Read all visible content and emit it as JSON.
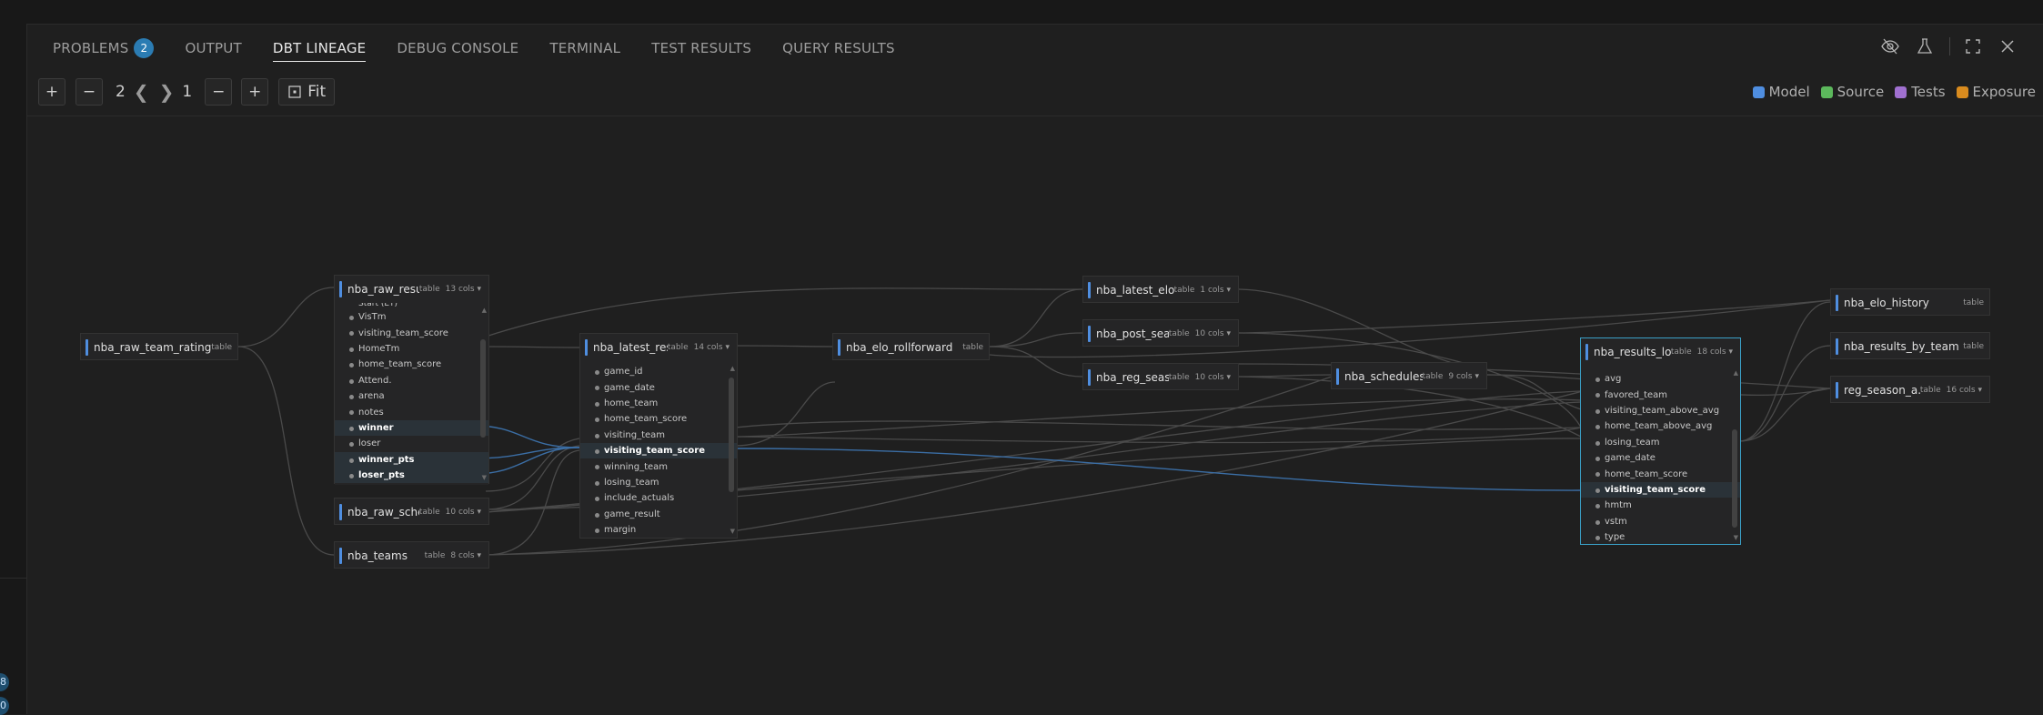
{
  "left_badges": [
    "8",
    "0"
  ],
  "tabs": [
    {
      "label": "PROBLEMS",
      "count": "2"
    },
    {
      "label": "OUTPUT"
    },
    {
      "label": "DBT LINEAGE"
    },
    {
      "label": "DEBUG CONSOLE"
    },
    {
      "label": "TERMINAL"
    },
    {
      "label": "TEST RESULTS"
    },
    {
      "label": "QUERY RESULTS"
    }
  ],
  "toolbar": {
    "zoom_in": "+",
    "zoom_out": "−",
    "upstream_depth": "2",
    "downstream_depth": "1",
    "depth_minus": "−",
    "depth_plus": "+",
    "fit_label": "Fit"
  },
  "legend": [
    {
      "label": "Model",
      "color": "#4f8ee0"
    },
    {
      "label": "Source",
      "color": "#5cb85c"
    },
    {
      "label": "Tests",
      "color": "#a070d0"
    },
    {
      "label": "Exposure",
      "color": "#d98b1e"
    }
  ],
  "nodes": {
    "raw_team_ratings": {
      "name": "nba_raw_team_ratings",
      "type": "table"
    },
    "raw_results": {
      "name": "nba_raw_results",
      "type": "table",
      "cols": "13 cols",
      "partial_column": "Start (ET)",
      "columns": [
        "VisTm",
        "visiting_team_score",
        "HomeTm",
        "home_team_score",
        "Attend.",
        "arena",
        "notes",
        "winner",
        "loser",
        "winner_pts",
        "loser_pts"
      ]
    },
    "raw_schedule": {
      "name": "nba_raw_sche...",
      "type": "table",
      "cols": "10 cols"
    },
    "teams": {
      "name": "nba_teams",
      "type": "table",
      "cols": "8 cols"
    },
    "latest_results": {
      "name": "nba_latest_res...",
      "type": "table",
      "cols": "14 cols",
      "columns": [
        "game_id",
        "game_date",
        "home_team",
        "home_team_score",
        "visiting_team",
        "visiting_team_score",
        "winning_team",
        "losing_team",
        "include_actuals",
        "game_result",
        "margin"
      ]
    },
    "elo_rollforward": {
      "name": "nba_elo_rollforward",
      "type": "table"
    },
    "latest_elo": {
      "name": "nba_latest_elo",
      "type": "table",
      "cols": "1 cols"
    },
    "post_season": {
      "name": "nba_post_sea...",
      "type": "table",
      "cols": "10 cols"
    },
    "reg_season": {
      "name": "nba_reg_seas...",
      "type": "table",
      "cols": "10 cols"
    },
    "schedules": {
      "name": "nba_schedules",
      "type": "table",
      "cols": "9 cols"
    },
    "results_log": {
      "name": "nba_results_log",
      "type": "table",
      "cols": "18 cols",
      "columns": [
        "avg",
        "favored_team",
        "visiting_team_above_avg",
        "home_team_above_avg",
        "losing_team",
        "game_date",
        "home_team_score",
        "visiting_team_score",
        "hmtm",
        "vstm",
        "type"
      ]
    },
    "elo_history": {
      "name": "nba_elo_history",
      "type": "table"
    },
    "results_by_team": {
      "name": "nba_results_by_team",
      "type": "table"
    },
    "reg_season_actuals": {
      "name": "reg_season_a...",
      "type": "table",
      "cols": "16 cols"
    }
  }
}
